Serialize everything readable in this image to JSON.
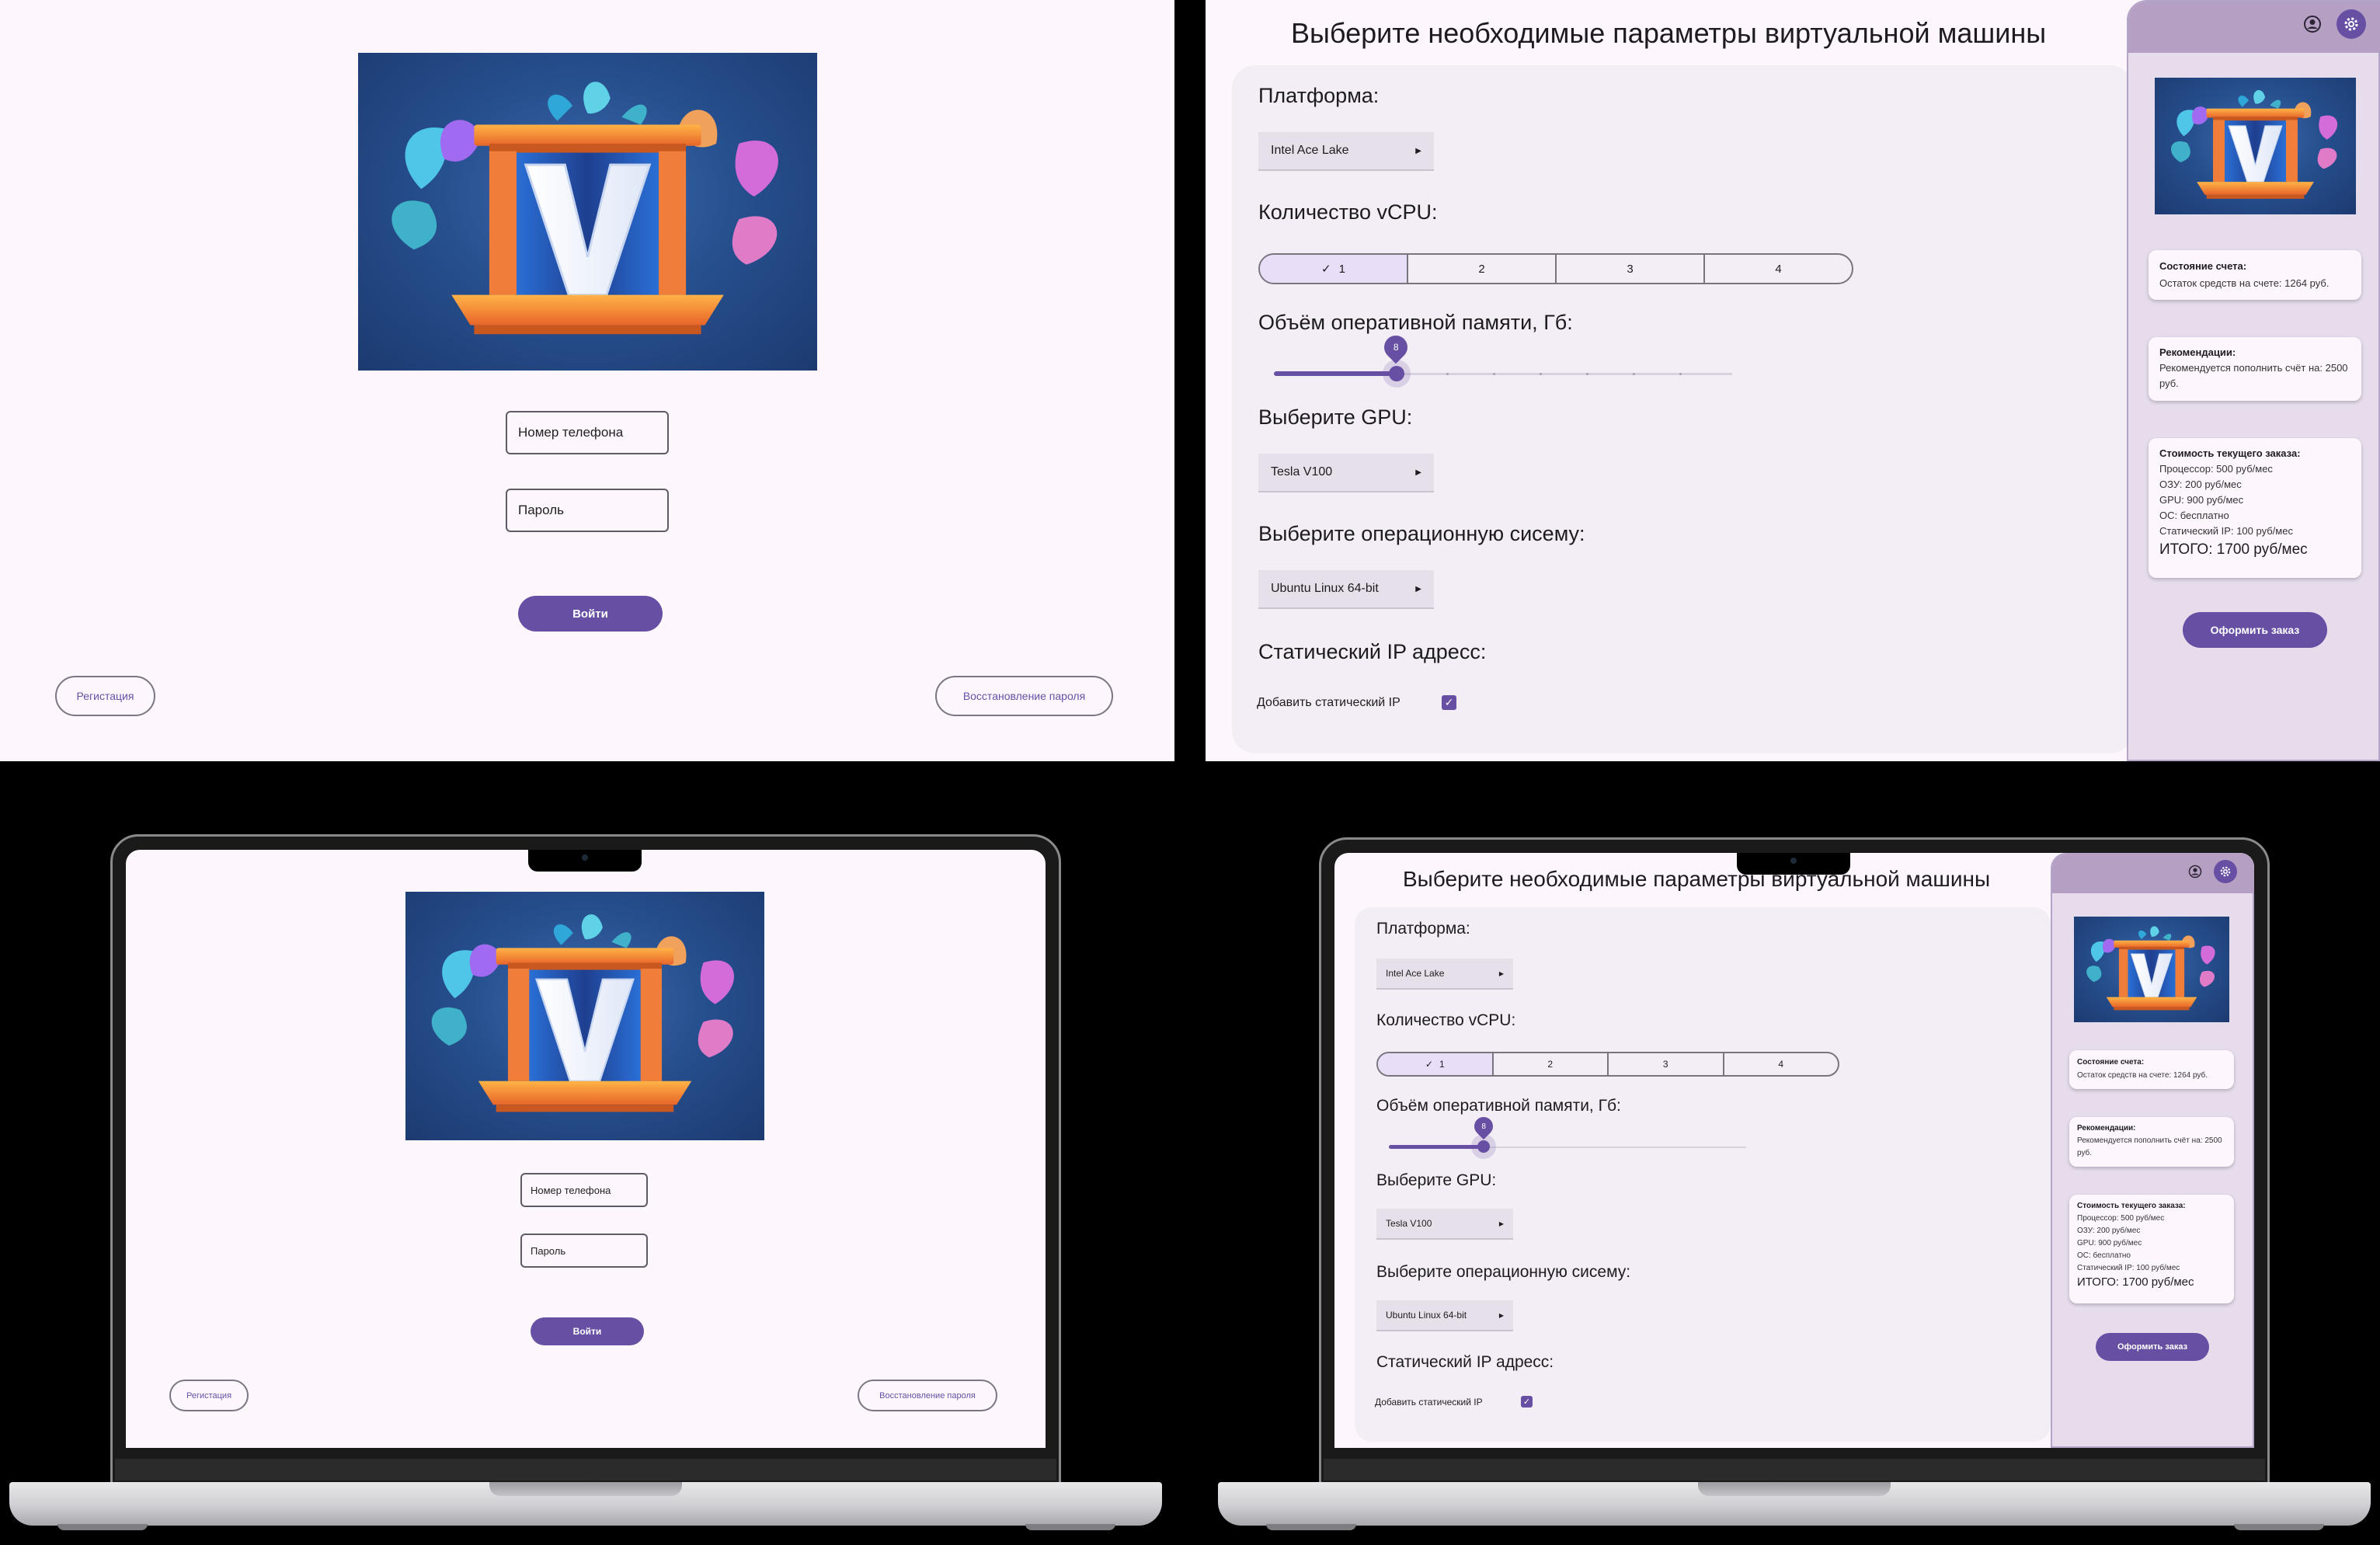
{
  "login": {
    "phone_placeholder": "Номер телефона",
    "password_placeholder": "Пароль",
    "login_button": "Войти",
    "register_button": "Регистация",
    "recover_button": "Восстановление пароля"
  },
  "logo": {
    "letter": "V"
  },
  "config": {
    "title": "Выберите необходимые параметры виртуальной машины",
    "platform_label": "Платформа:",
    "platform_value": "Intel Ace Lake",
    "vcpu_label": "Количество vCPU:",
    "vcpu_options": [
      "1",
      "2",
      "3",
      "4"
    ],
    "vcpu_selected": "1",
    "ram_label": "Объём оперативной памяти, Гб:",
    "ram_value": "8",
    "ram_fraction": 0.27,
    "gpu_label": "Выберите GPU:",
    "gpu_value": "Tesla V100",
    "os_label": "Выберите операционную сисему:",
    "os_value": "Ubuntu Linux 64-bit",
    "ip_label": "Статический IP адресс:",
    "ip_checkbox_label": "Добавить статический IP",
    "ip_checked": true
  },
  "sidebar": {
    "balance_title": "Состояние счета:",
    "balance_text": "Остаток средств на счете: 1264 руб.",
    "recommend_title": "Рекомендации:",
    "recommend_text": "Рекомендуется пополнить счёт на: 2500 руб.",
    "cost_title": "Стоимость текущего заказа:",
    "cost_lines": [
      "Процессор: 500 руб/мес",
      "ОЗУ: 200 руб/мес",
      "GPU: 900 руб/мес",
      "ОС: бесплатно",
      "Статический IP: 100 руб/мес"
    ],
    "cost_total": "ИТОГО: 1700 руб/мес",
    "order_button": "Оформить заказ"
  },
  "colors": {
    "accent": "#6750a4",
    "background": "#fdf7fd",
    "card": "#f3edf5",
    "sidebar": "#e6dcec",
    "sidebar_header": "#b5a0c4"
  },
  "icons": [
    "account-circle-icon",
    "settings-gear-icon",
    "chevron-right-icon",
    "check-icon"
  ]
}
